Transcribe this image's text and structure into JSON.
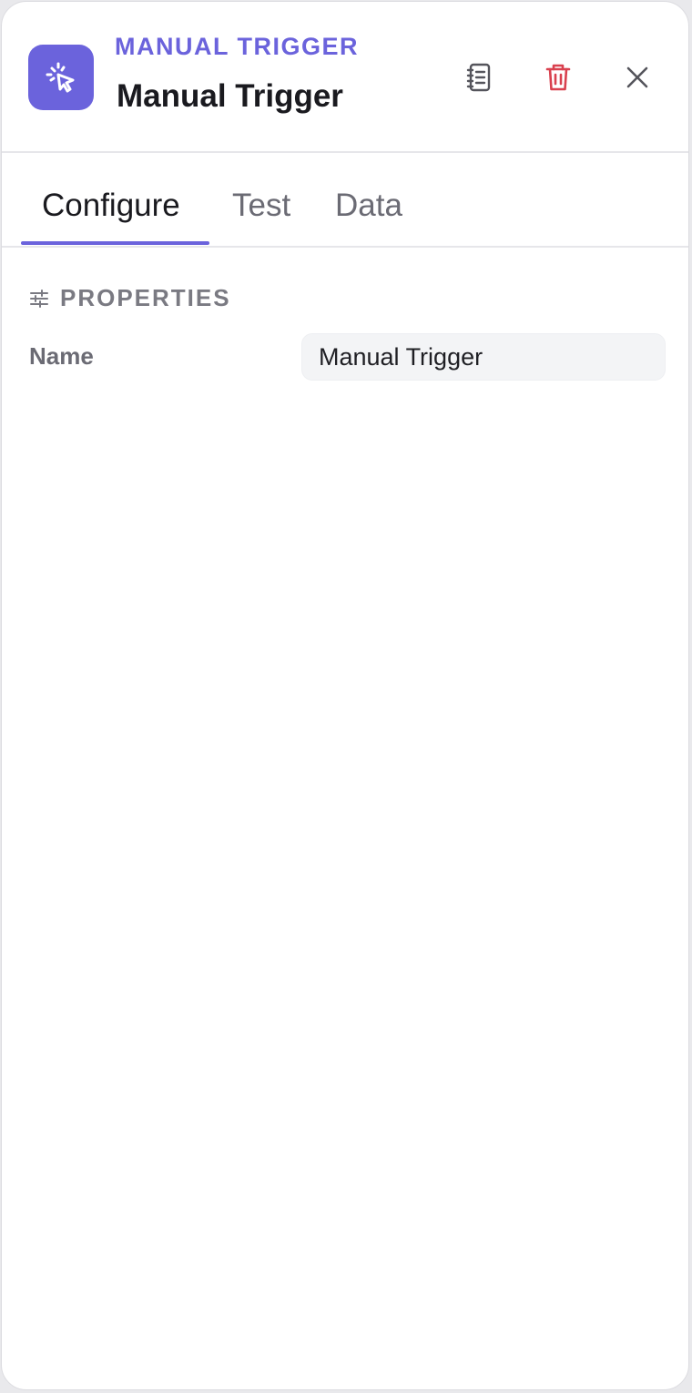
{
  "header": {
    "subtitle": "MANUAL TRIGGER",
    "title": "Manual Trigger",
    "node_icon": "cursor-click-icon",
    "actions": [
      {
        "name": "docs",
        "icon": "notebook-icon"
      },
      {
        "name": "delete",
        "icon": "trash-icon",
        "color": "#d9414f"
      },
      {
        "name": "close",
        "icon": "close-icon"
      }
    ]
  },
  "tabs": [
    {
      "label": "Configure",
      "active": true
    },
    {
      "label": "Test",
      "active": false
    },
    {
      "label": "Data",
      "active": false
    }
  ],
  "properties": {
    "section_title": "PROPERTIES",
    "section_icon": "sliders-icon",
    "name_label": "Name",
    "name_value": "Manual Trigger"
  },
  "colors": {
    "accent": "#6b63dc",
    "danger": "#d9414f"
  }
}
